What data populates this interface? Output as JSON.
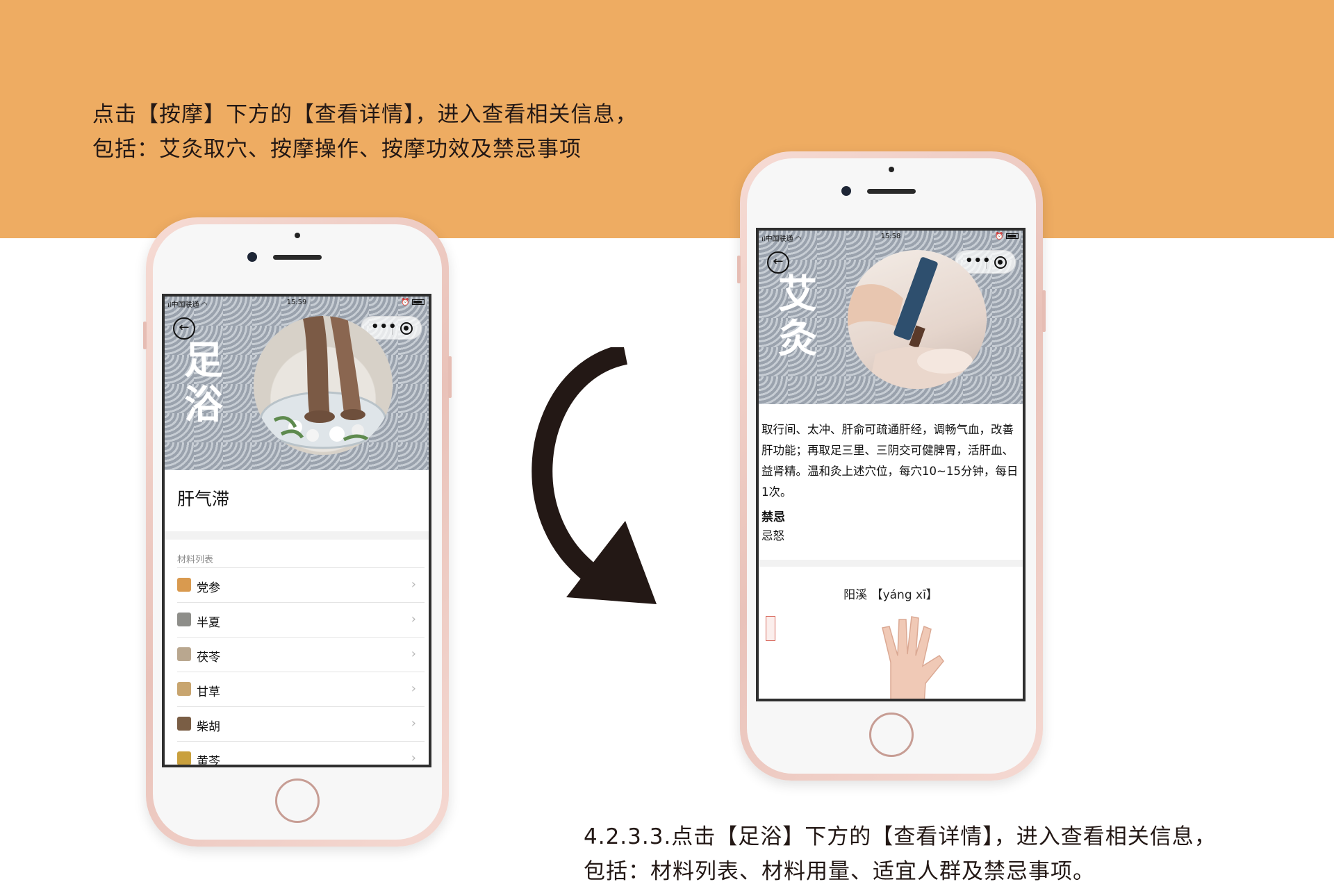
{
  "captions": {
    "top_line1": "点击【按摩】下方的【查看详情】，进入查看相关信息，",
    "top_line2": "包括：艾灸取穴、按摩操作、按摩功效及禁忌事项",
    "bottom_line1": "4.2.3.3.点击【足浴】下方的【查看详情】，进入查看相关信息，",
    "bottom_line2": "包括：材料列表、材料用量、适宜人群及禁忌事项。"
  },
  "phone_left": {
    "status": {
      "carrier": "中国联通",
      "time": "15:59"
    },
    "hero_title": "足浴",
    "recipe_title": "肝气滞",
    "section_label": "材料列表",
    "materials": [
      {
        "name": "党参",
        "chevron": "›",
        "color": "#d99a4f"
      },
      {
        "name": "半夏",
        "chevron": "›",
        "color": "#8e8e8a"
      },
      {
        "name": "茯苓",
        "chevron": "›",
        "color": "#b9a78f"
      },
      {
        "name": "甘草",
        "chevron": "›",
        "color": "#c8a56f"
      },
      {
        "name": "柴胡",
        "chevron": "›",
        "color": "#7a5e45"
      },
      {
        "name": "黄芩",
        "chevron": "›",
        "color": "#c9a03d"
      }
    ]
  },
  "phone_right": {
    "status": {
      "carrier": "中国联通",
      "time": "15:58"
    },
    "hero_title": "艾灸",
    "description": "取行间、太冲、肝俞可疏通肝经，调畅气血，改善肝功能；再取足三里、三阴交可健脾胃，活肝血、益肾精。温和灸上述穴位，每穴10~15分钟，每日1次。",
    "contraindication_heading": "禁忌",
    "contraindication_text": "忌怒",
    "acupoint_label": "阳溪 【yáng xī】"
  },
  "icons": {
    "back": "back-arrow-icon",
    "more": "more-dots-icon",
    "close": "target-close-icon",
    "wifi": "wifi-icon",
    "battery": "battery-icon"
  },
  "colors": {
    "banner": "#eeac62",
    "text": "#231815",
    "frame": "#e9c2b9"
  }
}
